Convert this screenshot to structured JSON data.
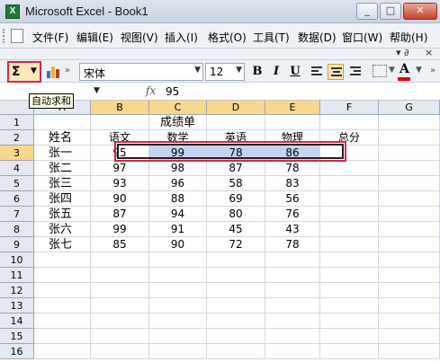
{
  "window": {
    "title": "Microsoft Excel - Book1",
    "app_icon": "excel-icon",
    "minimize": "_",
    "maximize": "□",
    "close": "✕"
  },
  "menu": {
    "items": [
      "文件(F)",
      "编辑(E)",
      "视图(V)",
      "插入(I)",
      "格式(O)",
      "工具(T)",
      "数据(D)",
      "窗口(W)",
      "帮助(H)"
    ],
    "doc_restore": "▾ ∂",
    "doc_close": "×"
  },
  "toolbar": {
    "autosum_glyph": "Σ",
    "autosum_tooltip": "自动求和",
    "font_name": "宋体",
    "font_size": "12",
    "bold": "B",
    "italic": "I",
    "underline": "U",
    "font_color_glyph": "A",
    "font_color": "#e00000"
  },
  "formula_bar": {
    "fx": "fx",
    "value": "95"
  },
  "sheet": {
    "columns": [
      "A",
      "B",
      "C",
      "D",
      "E",
      "F",
      "G"
    ],
    "rows": [
      "1",
      "2",
      "3",
      "4",
      "5",
      "6",
      "7",
      "8",
      "9",
      "10",
      "11",
      "12",
      "13",
      "14",
      "15",
      "16"
    ],
    "title": "成绩单",
    "headers": [
      "姓名",
      "语文",
      "数学",
      "英语",
      "物理",
      "总分"
    ],
    "data": [
      [
        "张一",
        "95",
        "99",
        "78",
        "86"
      ],
      [
        "张二",
        "97",
        "98",
        "87",
        "78"
      ],
      [
        "张三",
        "93",
        "96",
        "58",
        "83"
      ],
      [
        "张四",
        "90",
        "88",
        "69",
        "56"
      ],
      [
        "张五",
        "87",
        "94",
        "80",
        "76"
      ],
      [
        "张六",
        "99",
        "91",
        "45",
        "43"
      ],
      [
        "张七",
        "85",
        "90",
        "72",
        "78"
      ]
    ],
    "selection_color": "#c4d3ef",
    "highlight_color": "#d0284a"
  }
}
